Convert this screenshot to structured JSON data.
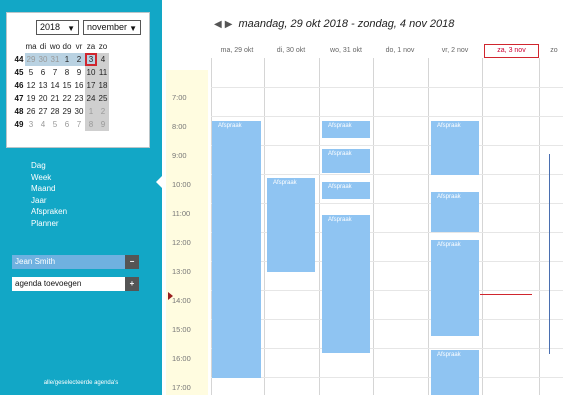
{
  "mini_calendar": {
    "year": "2018",
    "month": "november",
    "weekday_headers": [
      "ma",
      "di",
      "wo",
      "do",
      "vr",
      "za",
      "zo"
    ],
    "weeks": [
      {
        "week": "44",
        "days": [
          "29",
          "30",
          "31",
          "1",
          "2",
          "3",
          "4"
        ]
      },
      {
        "week": "45",
        "days": [
          "5",
          "6",
          "7",
          "8",
          "9",
          "10",
          "11"
        ]
      },
      {
        "week": "46",
        "days": [
          "12",
          "13",
          "14",
          "15",
          "16",
          "17",
          "18"
        ]
      },
      {
        "week": "47",
        "days": [
          "19",
          "20",
          "21",
          "22",
          "23",
          "24",
          "25"
        ]
      },
      {
        "week": "48",
        "days": [
          "26",
          "27",
          "28",
          "29",
          "30",
          "1",
          "2"
        ]
      },
      {
        "week": "49",
        "days": [
          "3",
          "4",
          "5",
          "6",
          "7",
          "8",
          "9"
        ]
      }
    ]
  },
  "views": [
    "Dag",
    "Week",
    "Maand",
    "Jaar",
    "Afspraken",
    "Planner"
  ],
  "agendas": {
    "user": "Jean Smith",
    "remove_label": "−",
    "add_label": "agenda toevoegen",
    "add_button": "+",
    "footer": "alle/geselecteerde agenda's"
  },
  "header": {
    "range_text": "maandag, 29 okt 2018 - zondag, 4 nov 2018",
    "prev_icon": "◀",
    "next_icon": "▶"
  },
  "columns": [
    "ma, 29 okt",
    "di, 30 okt",
    "wo, 31 okt",
    "do, 1 nov",
    "vr, 2 nov",
    "za, 3 nov",
    "zo"
  ],
  "times": [
    "7:00",
    "8:00",
    "9:00",
    "10:00",
    "11:00",
    "12:00",
    "13:00",
    "14:00",
    "15:00",
    "16:00",
    "17:00"
  ],
  "event_label": "Afspraak",
  "colors": {
    "sidebar": "#12a7c6",
    "event": "#8fc4f2",
    "today_border": "#d0262e"
  }
}
